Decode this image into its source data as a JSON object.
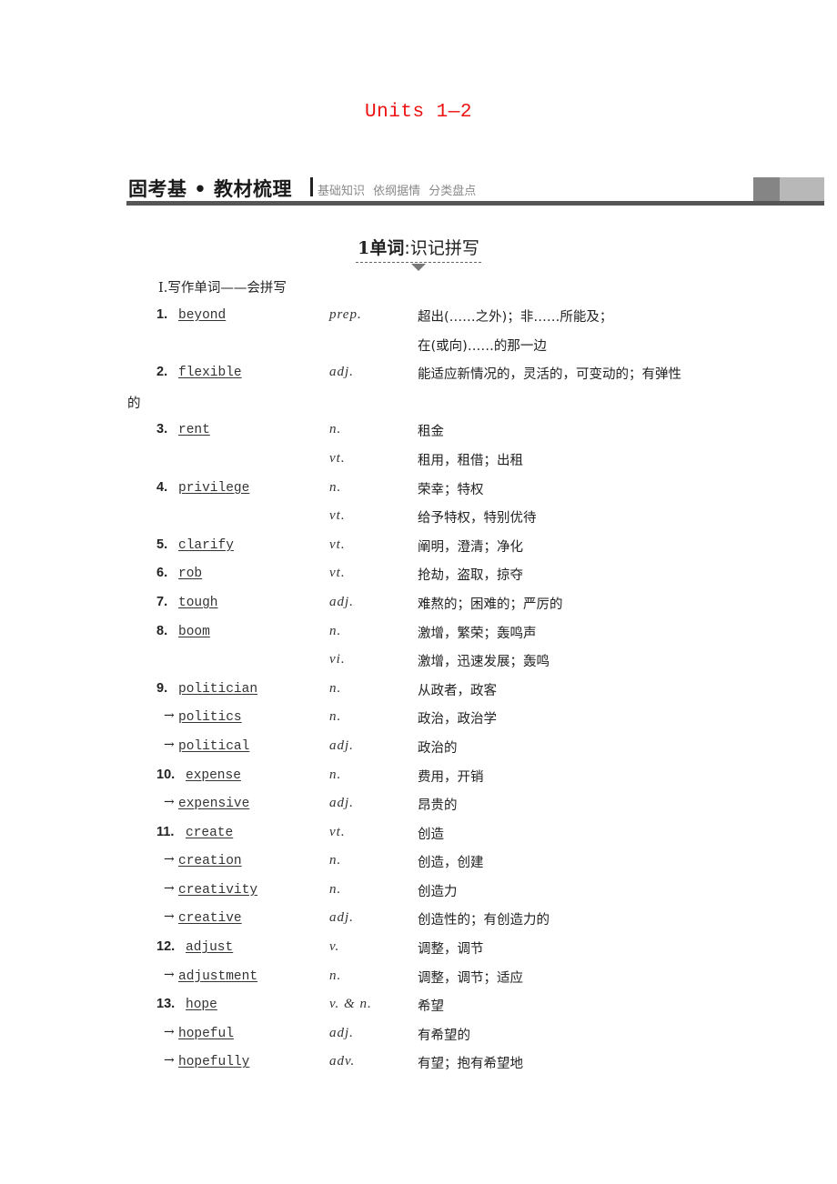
{
  "title": "Units 1—2",
  "section_header": {
    "main": "固考基 • 教材梳理",
    "sub": "基础知识 依纲据情 分类盘点"
  },
  "sub_heading": {
    "number": "1",
    "bold": "单词",
    "rest": ":识记拼写"
  },
  "part_title": "Ⅰ.写作单词——会拼写",
  "entries": [
    {
      "num": "1.",
      "word": "beyond",
      "pos": "prep.",
      "meaning": "超出(……之外)；非……所能及；"
    },
    {
      "num": "",
      "word": "",
      "pos": "",
      "meaning": "在(或向)……的那一边"
    },
    {
      "num": "2.",
      "word": "flexible",
      "pos": "adj.",
      "meaning": "能适应新情况的，灵活的，可变动的；有弹性"
    },
    {
      "num": "",
      "word": "",
      "pos": "",
      "meaning": "",
      "tail": "的"
    },
    {
      "num": "3.",
      "word": "rent",
      "pos": "n.",
      "meaning": "租金"
    },
    {
      "num": "",
      "word": "",
      "pos": "vt.",
      "meaning": "租用，租借；出租"
    },
    {
      "num": "4.",
      "word": "privilege",
      "pos": "n.",
      "meaning": "荣幸；特权"
    },
    {
      "num": "",
      "word": "",
      "pos": "vt.",
      "meaning": "给予特权，特别优待"
    },
    {
      "num": "5.",
      "word": "clarify",
      "pos": "vt.",
      "meaning": "阐明，澄清；净化"
    },
    {
      "num": "6.",
      "word": "rob",
      "pos": "vt.",
      "meaning": "抢劫，盗取，掠夺"
    },
    {
      "num": "7.",
      "word": "tough",
      "pos": "adj.",
      "meaning": "难熬的；困难的；严厉的"
    },
    {
      "num": "8.",
      "word": "boom",
      "pos": "n.",
      "meaning": "激增，繁荣；轰鸣声"
    },
    {
      "num": "",
      "word": "",
      "pos": "vi.",
      "meaning": "激增，迅速发展；轰鸣"
    },
    {
      "num": "9.",
      "word": "politician",
      "pos": "n.",
      "meaning": "从政者，政客"
    },
    {
      "derived": true,
      "word": "politics",
      "pos": "n.",
      "meaning": "政治，政治学"
    },
    {
      "derived": true,
      "word": "political",
      "pos": "adj.",
      "meaning": "政治的"
    },
    {
      "num": "10.",
      "word": "expense",
      "pos": "n.",
      "meaning": "费用，开销"
    },
    {
      "derived": true,
      "word": "expensive",
      "pos": "adj.",
      "meaning": "昂贵的"
    },
    {
      "num": "11.",
      "word": "create",
      "pos": "vt.",
      "meaning": "创造"
    },
    {
      "derived": true,
      "word": "creation",
      "pos": "n.",
      "meaning": "创造，创建"
    },
    {
      "derived": true,
      "word": "creativity",
      "pos": "n.",
      "meaning": "创造力"
    },
    {
      "derived": true,
      "word": "creative",
      "pos": "adj.",
      "meaning": "创造性的；有创造力的"
    },
    {
      "num": "12.",
      "word": "adjust",
      "pos": "v.",
      "meaning": "调整，调节"
    },
    {
      "derived": true,
      "word": "adjustment",
      "pos": "n.",
      "meaning": "调整，调节；适应"
    },
    {
      "num": "13.",
      "word": "hope",
      "pos": "v. & n.",
      "meaning": "希望"
    },
    {
      "derived": true,
      "word": "hopeful",
      "pos": "adj.",
      "meaning": "有希望的"
    },
    {
      "derived": true,
      "word": "hopefully",
      "pos": "adv.",
      "meaning": "有望；抱有希望地"
    }
  ],
  "arrow_glyph": "→",
  "colors": {
    "title": "#ee1111",
    "header_rule": "#555555",
    "header_sub": "#8a8a8a"
  }
}
